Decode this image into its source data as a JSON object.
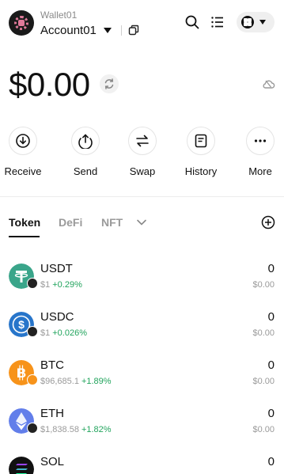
{
  "header": {
    "wallet_name": "Wallet01",
    "account_name": "Account01"
  },
  "balance": {
    "total": "$0.00"
  },
  "actions": [
    {
      "label": "Receive",
      "icon": "receive-icon"
    },
    {
      "label": "Send",
      "icon": "send-icon"
    },
    {
      "label": "Swap",
      "icon": "swap-icon"
    },
    {
      "label": "History",
      "icon": "history-icon"
    },
    {
      "label": "More",
      "icon": "more-icon"
    }
  ],
  "tabs": [
    {
      "label": "Token",
      "active": true
    },
    {
      "label": "DeFi",
      "active": false
    },
    {
      "label": "NFT",
      "active": false
    }
  ],
  "tokens": [
    {
      "symbol": "USDT",
      "price": "$1",
      "change": "+0.29%",
      "amount": "0",
      "value": "$0.00",
      "color": "#3aa58a"
    },
    {
      "symbol": "USDC",
      "price": "$1",
      "change": "+0.026%",
      "amount": "0",
      "value": "$0.00",
      "color": "#2775ca"
    },
    {
      "symbol": "BTC",
      "price": "$96,685.1",
      "change": "+1.89%",
      "amount": "0",
      "value": "$0.00",
      "color": "#f7931a"
    },
    {
      "symbol": "ETH",
      "price": "$1,838.58",
      "change": "+1.82%",
      "amount": "0",
      "value": "$0.00",
      "color": "#627eea"
    },
    {
      "symbol": "SOL",
      "price": "",
      "change": "",
      "amount": "0",
      "value": "",
      "color": "#111111"
    }
  ],
  "colors": {
    "positive": "#22a45d",
    "muted": "#9a9a9a"
  }
}
